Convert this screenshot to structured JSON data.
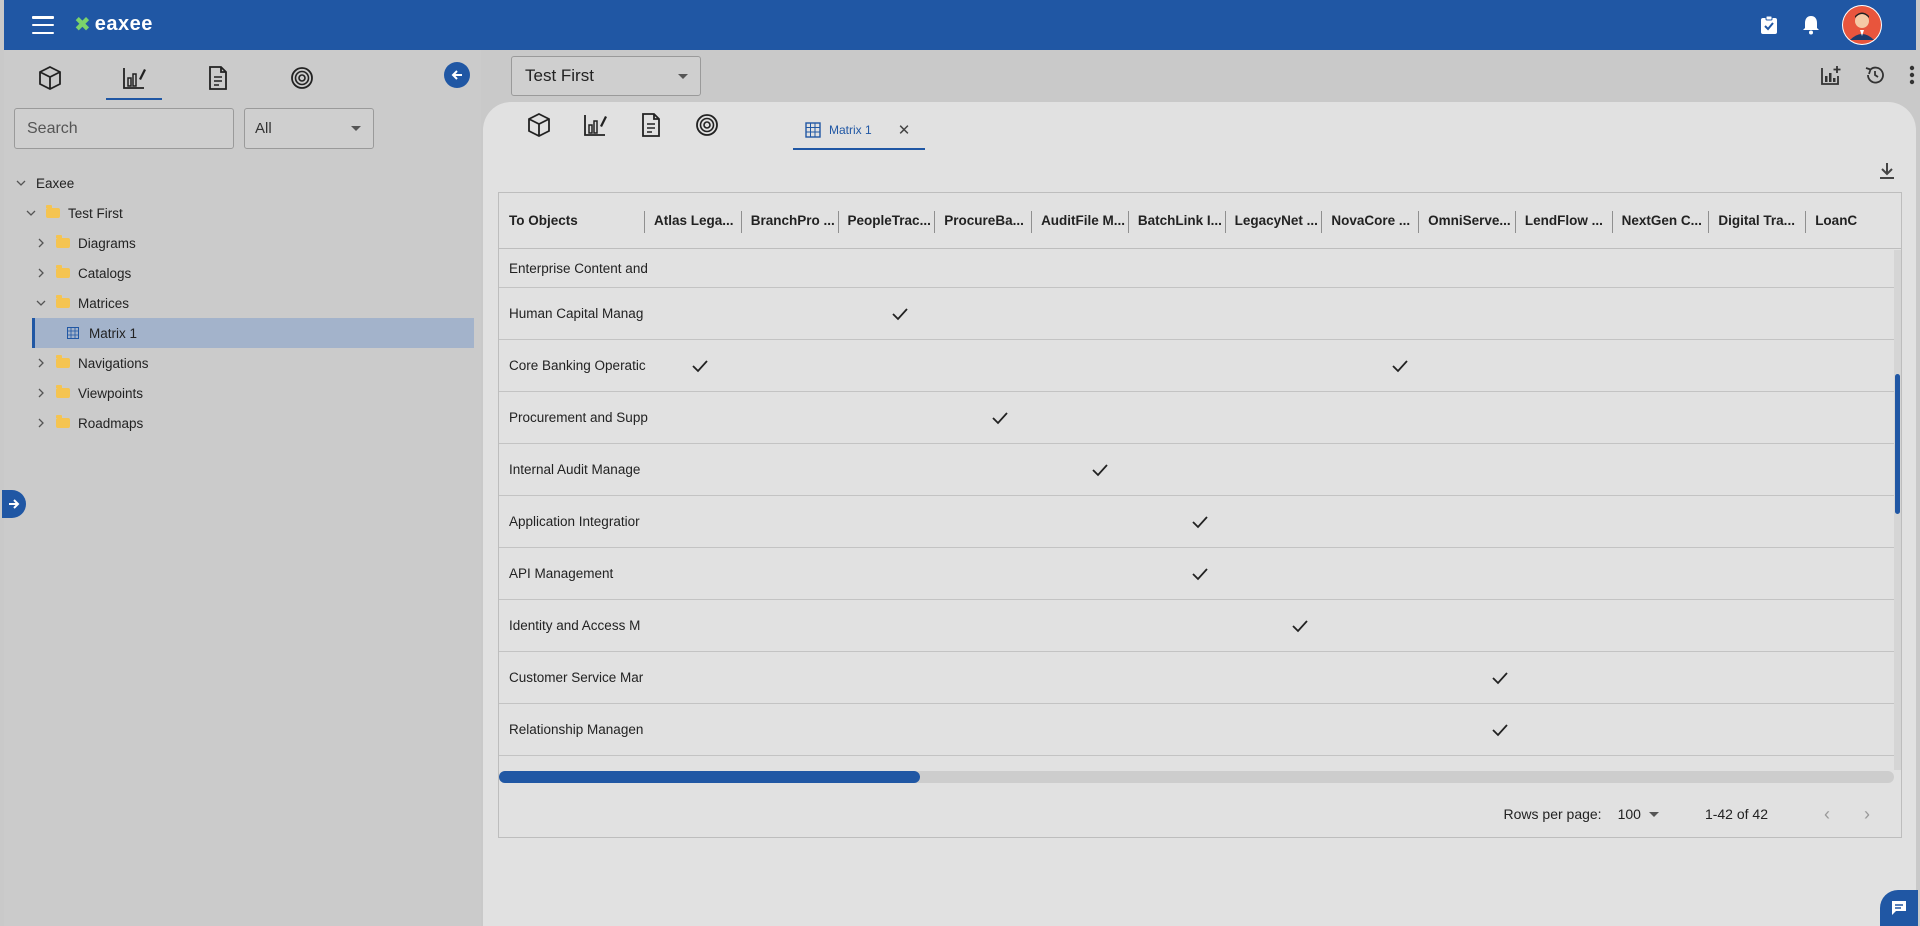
{
  "app": {
    "logo_mark": "✖",
    "logo_text": "eaxee",
    "accent": "#2057a4"
  },
  "topbar": {
    "icons": [
      "tasks-check-icon",
      "bell-icon",
      "avatar"
    ]
  },
  "left": {
    "tabs": [
      "cube-icon",
      "chart-edit-icon",
      "document-icon",
      "target-icon"
    ],
    "search": {
      "placeholder": "Search"
    },
    "filter": {
      "value": "All"
    },
    "tree": [
      {
        "label": "Eaxee",
        "level": 0,
        "expanded": true,
        "type": "root"
      },
      {
        "label": "Test First",
        "level": 1,
        "expanded": true,
        "type": "folder"
      },
      {
        "label": "Diagrams",
        "level": 2,
        "expanded": false,
        "type": "folder"
      },
      {
        "label": "Catalogs",
        "level": 2,
        "expanded": false,
        "type": "folder"
      },
      {
        "label": "Matrices",
        "level": 2,
        "expanded": true,
        "type": "folder"
      },
      {
        "label": "Matrix 1",
        "level": 3,
        "type": "matrix",
        "selected": true
      },
      {
        "label": "Navigations",
        "level": 2,
        "expanded": false,
        "type": "folder"
      },
      {
        "label": "Viewpoints",
        "level": 2,
        "expanded": false,
        "type": "folder"
      },
      {
        "label": "Roadmaps",
        "level": 2,
        "expanded": false,
        "type": "folder"
      }
    ]
  },
  "right": {
    "selector": {
      "value": "Test First"
    },
    "doc_tab": {
      "label": "Matrix 1",
      "close": "✕"
    },
    "grid": {
      "corner_label": "To Objects",
      "columns": [
        "Atlas Lega...",
        "BranchPro ...",
        "PeopleTrac...",
        "ProcureBa...",
        "AuditFile M...",
        "BatchLink I...",
        "LegacyNet ...",
        "NovaCore ...",
        "OmniServe...",
        "LendFlow ...",
        "NextGen C...",
        "Digital Tra...",
        "LoanC"
      ],
      "rows": [
        {
          "name": "Enterprise Content and",
          "checks": []
        },
        {
          "name": "Human Capital Manag",
          "checks": [
            2
          ]
        },
        {
          "name": "Core Banking Operatic",
          "checks": [
            0,
            7
          ]
        },
        {
          "name": "Procurement and Supp",
          "checks": [
            3
          ]
        },
        {
          "name": "Internal Audit Manage",
          "checks": [
            4
          ]
        },
        {
          "name": "Application Integratior",
          "checks": [
            5
          ]
        },
        {
          "name": "API Management",
          "checks": [
            5
          ]
        },
        {
          "name": "Identity and Access M",
          "checks": [
            6
          ]
        },
        {
          "name": "Customer Service Mar",
          "checks": [
            8
          ]
        },
        {
          "name": "Relationship Managen",
          "checks": [
            8
          ]
        }
      ]
    },
    "pager": {
      "label": "Rows per page:",
      "rows_per_page": "100",
      "range": "1-42 of 42"
    }
  }
}
